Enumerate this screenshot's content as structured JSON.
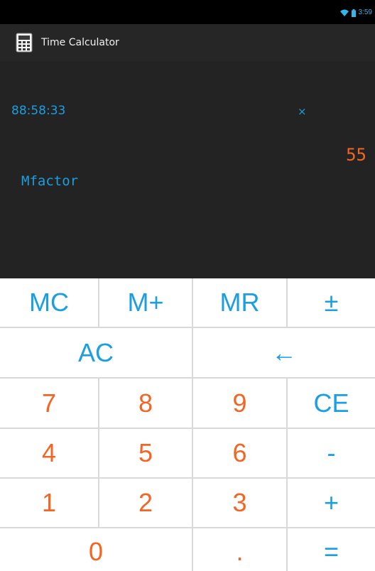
{
  "status_bar": {
    "time": "3:59"
  },
  "app": {
    "title": "Time Calculator"
  },
  "display": {
    "time": "88:58:33",
    "operator": "×",
    "value": "55",
    "label": "Mfactor"
  },
  "keys": {
    "mc": "MC",
    "mplus": "M+",
    "mr": "MR",
    "plusminus": "±",
    "ac": "AC",
    "backspace": "←",
    "k7": "7",
    "k8": "8",
    "k9": "9",
    "ce": "CE",
    "k4": "4",
    "k5": "5",
    "k6": "6",
    "minus": "-",
    "k1": "1",
    "k2": "2",
    "k3": "3",
    "plus": "+",
    "k0": "0",
    "dot": ".",
    "equals": "="
  },
  "colors": {
    "accent_blue": "#1a9fe0",
    "accent_orange": "#f26522",
    "display_bg": "#232323",
    "keypad_bg": "#ffffff"
  }
}
